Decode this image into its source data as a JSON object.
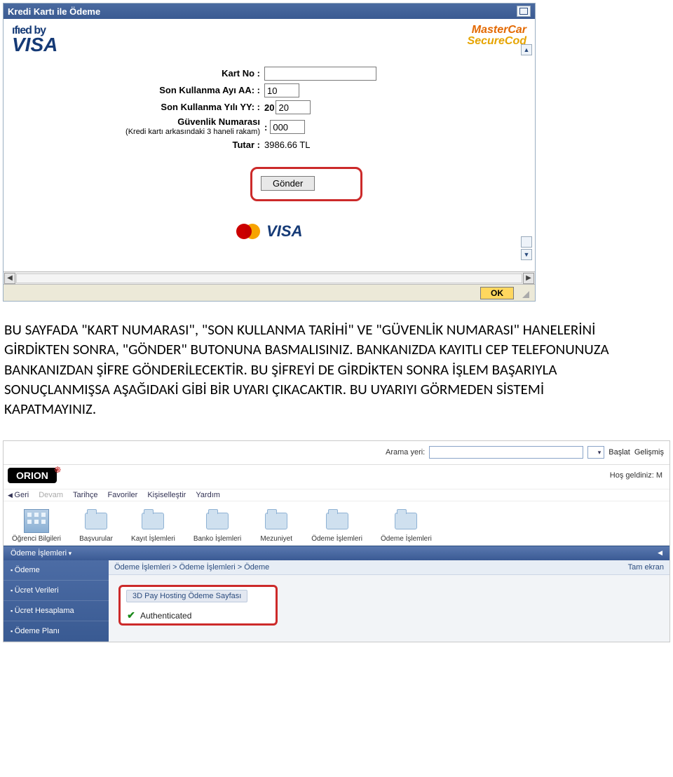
{
  "payWindow": {
    "title": "Kredi Kartı ile Ödeme",
    "brands": {
      "vbv_line1": "ıfıed by",
      "vbv_line2": "VISA",
      "msc_line1": "MasterCar",
      "msc_line2": "SecureCod"
    },
    "fields": {
      "cardno_label": "Kart No :",
      "cardno_value": "",
      "exp_mm_label": "Son Kullanma Ayı AA: :",
      "exp_mm_value": "10",
      "exp_yy_label": "Son Kullanma Yılı YY: :",
      "exp_yy_prefix": "20",
      "exp_yy_value": "20",
      "cvv_label": "Güvenlik Numarası",
      "cvv_sub": "(Kredi kartı arkasındaki 3 haneli rakam)",
      "cvv_colon": ":",
      "cvv_value": "000",
      "amount_label": "Tutar :",
      "amount_value": "3986.66 TL"
    },
    "submit_label": "Gönder",
    "ok_label": "OK"
  },
  "instruction": "BU SAYFADA \"KART NUMARASI\", \"SON KULLANMA TARİHİ\" VE \"GÜVENLİK NUMARASI\" HANELERİNİ GİRDİKTEN SONRA, \"GÖNDER\" BUTONUNA BASMALISINIZ. BANKANIZDA KAYITLI CEP TELEFONUNUZA BANKANIZDAN ŞİFRE GÖNDERİLECEKTİR. BU ŞİFREYİ DE GİRDİKTEN SONRA İŞLEM BAŞARIYLA SONUÇLANMIŞSA AŞAĞIDAKİ GİBİ BİR UYARI ÇIKACAKTIR. BU UYARIYI GÖRMEDEN SİSTEMİ KAPATMAYINIZ.",
  "orion": {
    "search_label": "Arama yeri:",
    "search_value": "",
    "search_dropdown": "",
    "start_label": "Başlat",
    "advanced_label": "Gelişmiş",
    "logo_text": "ORION",
    "welcome": "Hoş geldiniz: M",
    "menu": {
      "back": "Geri",
      "forward": "Devam",
      "history": "Tarihçe",
      "favorites": "Favoriler",
      "personalize": "Kişiselleştir",
      "help": "Yardım"
    },
    "modules": [
      "Öğrenci Bilgileri",
      "Başvurular",
      "Kayıt İşlemleri",
      "Banko İşlemleri",
      "Mezuniyet",
      "Ödeme İşlemleri",
      "Ödeme İşlemleri"
    ],
    "section_header": "Ödeme İşlemleri",
    "sidebar": [
      "Ödeme",
      "Ücret Verileri",
      "Ücret Hesaplama",
      "Ödeme Planı"
    ],
    "crumbs": "Ödeme İşlemleri  >  Ödeme İşlemleri  >  Ödeme",
    "fullscreen": "Tam ekran",
    "tab_label": "3D Pay Hosting Ödeme Sayfası",
    "auth_label": "Authenticated"
  }
}
